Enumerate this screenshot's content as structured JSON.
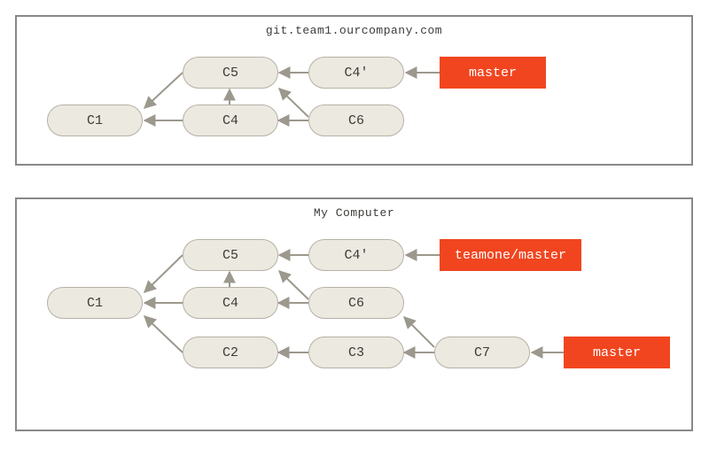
{
  "server": {
    "title": "git.team1.ourcompany.com",
    "commits": {
      "c1": "C1",
      "c4": "C4",
      "c5": "C5",
      "c6": "C6",
      "c4p": "C4'"
    },
    "refs": {
      "master": "master"
    }
  },
  "local": {
    "title": "My Computer",
    "commits": {
      "c1": "C1",
      "c2": "C2",
      "c3": "C3",
      "c4": "C4",
      "c5": "C5",
      "c6": "C6",
      "c4p": "C4'",
      "c7": "C7"
    },
    "refs": {
      "teamone_master": "teamone/master",
      "master": "master"
    }
  },
  "chart_data": [
    {
      "type": "graph",
      "title": "git.team1.ourcompany.com",
      "nodes": [
        "C1",
        "C4",
        "C5",
        "C6",
        "C4'"
      ],
      "edges": [
        [
          "C4",
          "C1"
        ],
        [
          "C5",
          "C1"
        ],
        [
          "C5",
          "C4"
        ],
        [
          "C6",
          "C4"
        ],
        [
          "C6",
          "C5"
        ],
        [
          "C4'",
          "C5"
        ]
      ],
      "refs": [
        {
          "name": "master",
          "points_to": "C4'"
        }
      ]
    },
    {
      "type": "graph",
      "title": "My Computer",
      "nodes": [
        "C1",
        "C2",
        "C3",
        "C4",
        "C5",
        "C6",
        "C4'",
        "C7"
      ],
      "edges": [
        [
          "C2",
          "C1"
        ],
        [
          "C3",
          "C2"
        ],
        [
          "C4",
          "C1"
        ],
        [
          "C5",
          "C1"
        ],
        [
          "C5",
          "C4"
        ],
        [
          "C6",
          "C4"
        ],
        [
          "C6",
          "C5"
        ],
        [
          "C4'",
          "C5"
        ],
        [
          "C7",
          "C3"
        ],
        [
          "C7",
          "C6"
        ]
      ],
      "refs": [
        {
          "name": "teamone/master",
          "points_to": "C4'"
        },
        {
          "name": "master",
          "points_to": "C7"
        }
      ]
    }
  ]
}
